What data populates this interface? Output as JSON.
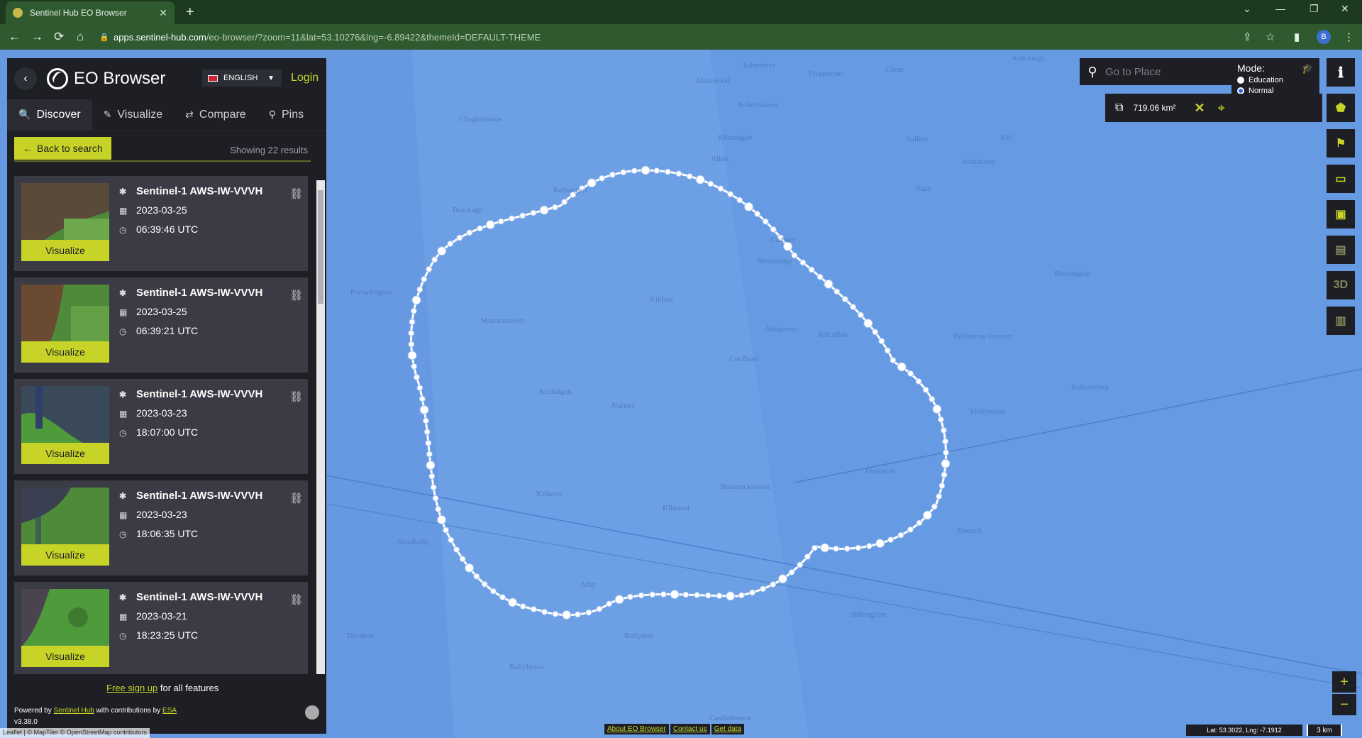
{
  "browser": {
    "tab_title": "Sentinel Hub EO Browser",
    "url_domain": "apps.sentinel-hub.com",
    "url_path": "/eo-browser/?zoom=11&lat=53.10276&lng=-6.89422&themeId=DEFAULT-THEME",
    "profile_initial": "B"
  },
  "sidebar": {
    "title": "EO Browser",
    "language": "ENGLISH",
    "login": "Login",
    "tabs": [
      {
        "label": "Discover",
        "icon": "search-icon"
      },
      {
        "label": "Visualize",
        "icon": "brush-icon"
      },
      {
        "label": "Compare",
        "icon": "compare-icon"
      },
      {
        "label": "Pins",
        "icon": "pin-icon"
      }
    ],
    "back_to_search": "Back to search",
    "showing": "Showing 22 results",
    "visualize_label": "Visualize",
    "results": [
      {
        "title": "Sentinel-1 AWS-IW-VVVH",
        "date": "2023-03-25",
        "time": "06:39:46 UTC"
      },
      {
        "title": "Sentinel-1 AWS-IW-VVVH",
        "date": "2023-03-25",
        "time": "06:39:21 UTC"
      },
      {
        "title": "Sentinel-1 AWS-IW-VVVH",
        "date": "2023-03-23",
        "time": "18:07:00 UTC"
      },
      {
        "title": "Sentinel-1 AWS-IW-VVVH",
        "date": "2023-03-23",
        "time": "18:06:35 UTC"
      },
      {
        "title": "Sentinel-1 AWS-IW-VVVH",
        "date": "2023-03-21",
        "time": "18:23:25 UTC"
      }
    ],
    "footer": {
      "free_signup": "Free sign up",
      "free_signup_suffix": " for all features",
      "powered_prefix": "Powered by ",
      "powered_link": "Sentinel Hub",
      "powered_mid": " with contributions by ",
      "powered_esa": "ESA",
      "version": "v3.38.0"
    }
  },
  "map": {
    "search_placeholder": "Go to Place",
    "mode_title": "Mode:",
    "mode_options": [
      "Education",
      "Normal"
    ],
    "mode_selected": "Normal",
    "aoi_area": "719.06 km²",
    "right_tools": [
      "info-icon",
      "pentagon-icon",
      "location-pin-icon",
      "ruler-icon",
      "image-download-icon",
      "film-icon",
      "3D",
      "chart-icon"
    ],
    "zoom_in": "+",
    "zoom_out": "−",
    "bottom_links": [
      "About EO Browser",
      "Contact us",
      "Get data"
    ],
    "coords": "Lat: 53.3022, Lng: -7.1912",
    "scale": "3 km",
    "attribution": "Leaflet | © MapTiler © OpenStreetMap contributors",
    "place_labels": [
      "Edenderry",
      "Allenwood",
      "Prosperous",
      "Clane",
      "Ardclough",
      "Carbury",
      "Robertstown",
      "Johnstown",
      "Clogherinkoe",
      "Kilmeague",
      "Allen",
      "Sallins",
      "Rathangan",
      "Brockagh",
      "Naas",
      "Newbridge",
      "Kill",
      "Portarlington",
      "Monasterevin",
      "Kildare",
      "Kilcullen",
      "Blessington",
      "Cut Bush",
      "Athgarvan",
      "Ballymore Eustace",
      "Kildangan",
      "Nurney",
      "Ballyfermot",
      "Hollywood",
      "Kilberry",
      "Brannockstown",
      "Dunlavin",
      "Stradbally",
      "Athy",
      "Kilmead",
      "Donard",
      "Timahoe",
      "Ballytore",
      "Baltinglass",
      "Castledermot",
      "Ballylynan"
    ]
  }
}
